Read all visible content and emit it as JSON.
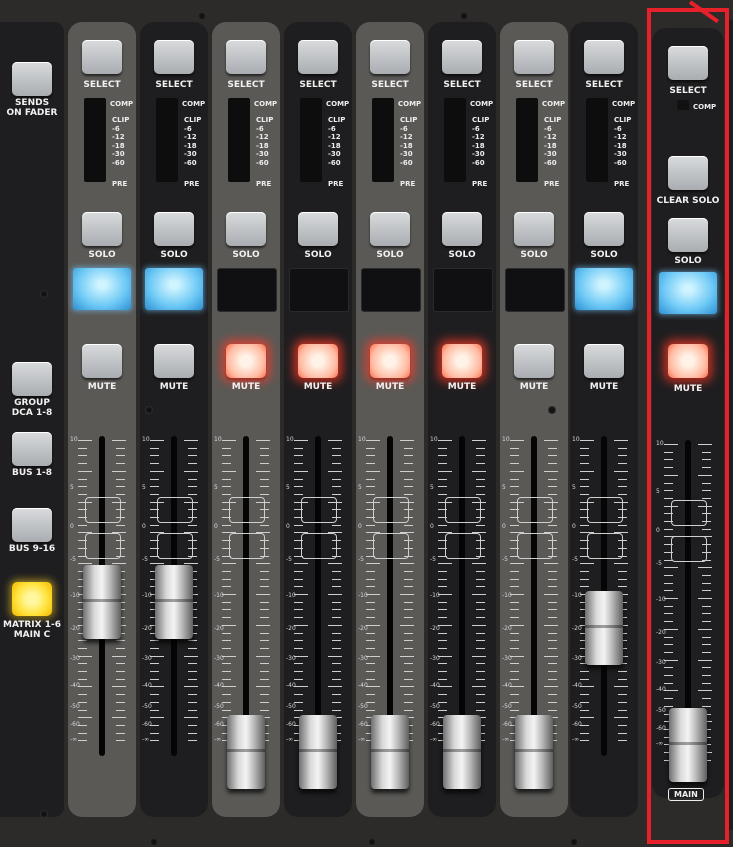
{
  "left_panel": {
    "buttons": [
      {
        "label": "SENDS\nON FADER",
        "lit": false
      },
      {
        "label": "GROUP\nDCA 1-8",
        "lit": false
      },
      {
        "label": "BUS 1-8",
        "lit": false
      },
      {
        "label": "BUS 9-16",
        "lit": false
      },
      {
        "label": "MATRIX 1-6\nMAIN C",
        "lit": true
      }
    ]
  },
  "meter_labels": {
    "comp": "COMP",
    "scale": [
      "CLIP",
      "-6",
      "-12",
      "-18",
      "-30",
      "-60"
    ],
    "pre": "PRE"
  },
  "channels": [
    {
      "select": "SELECT",
      "solo": "SOLO",
      "mute": "MUTE",
      "mute_lit": false,
      "display_lit": true,
      "fader_level": 0.58,
      "strip": "light"
    },
    {
      "select": "SELECT",
      "solo": "SOLO",
      "mute": "MUTE",
      "mute_lit": false,
      "display_lit": true,
      "fader_level": 0.58,
      "strip": "dark"
    },
    {
      "select": "SELECT",
      "solo": "SOLO",
      "mute": "MUTE",
      "mute_lit": true,
      "display_lit": false,
      "fader_level": 0.0,
      "strip": "light"
    },
    {
      "select": "SELECT",
      "solo": "SOLO",
      "mute": "MUTE",
      "mute_lit": true,
      "display_lit": false,
      "fader_level": 0.0,
      "strip": "dark"
    },
    {
      "select": "SELECT",
      "solo": "SOLO",
      "mute": "MUTE",
      "mute_lit": true,
      "display_lit": false,
      "fader_level": 0.0,
      "strip": "light"
    },
    {
      "select": "SELECT",
      "solo": "SOLO",
      "mute": "MUTE",
      "mute_lit": true,
      "display_lit": false,
      "fader_level": 0.0,
      "strip": "dark"
    },
    {
      "select": "SELECT",
      "solo": "SOLO",
      "mute": "MUTE",
      "mute_lit": false,
      "display_lit": false,
      "fader_level": 0.0,
      "strip": "light"
    },
    {
      "select": "SELECT",
      "solo": "SOLO",
      "mute": "MUTE",
      "mute_lit": false,
      "display_lit": true,
      "fader_level": 0.48,
      "strip": "dark"
    }
  ],
  "main": {
    "select": "SELECT",
    "comp": "COMP",
    "clear_solo": "CLEAR SOLO",
    "solo": "SOLO",
    "mute": "MUTE",
    "mute_lit": true,
    "display_lit": true,
    "fader_level": 0.0,
    "name": "MAIN"
  },
  "fader_scale": [
    "10",
    "5",
    "0",
    "-5",
    "-10",
    "-20",
    "-30",
    "-40",
    "-50",
    "-60",
    "-∞"
  ],
  "colors": {
    "highlight_box": "#e8202a",
    "mute_lit": "#ff6a4a",
    "lcd_lit": "#6cc8f5",
    "matrix_lit": "#ffe23a"
  }
}
